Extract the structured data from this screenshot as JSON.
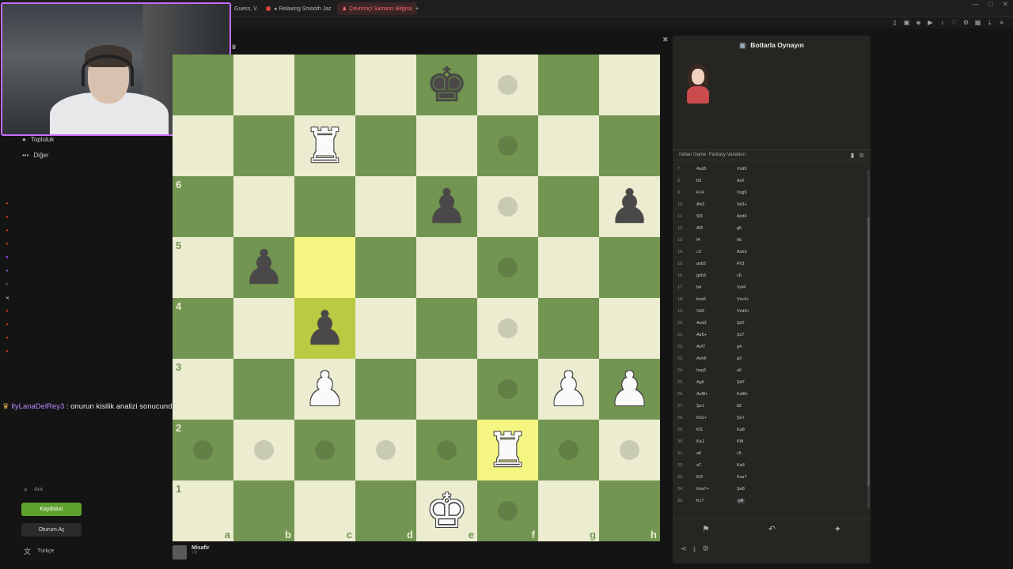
{
  "browser": {
    "tabs": [
      {
        "label": "Guess, V",
        "active": false
      },
      {
        "label": "Relaxing Smooth Jaz",
        "active": false
      },
      {
        "label": "Çevrimiçi Satrancı Bilgisa",
        "active": true
      },
      {
        "label": "+",
        "active": false
      }
    ]
  },
  "sidebar": {
    "items": [
      {
        "label": "Topluluk"
      },
      {
        "label": "Diğer",
        "icon": "more-icon"
      }
    ],
    "search_label": "Ara",
    "signup_label": "Kaydolun",
    "login_label": "Oturum Aç",
    "language_label": "Türkçe"
  },
  "chat": {
    "username": "IlyLanaDelRey3",
    "message": ": onurun kisilik analizi sonucunda bir seyler bul"
  },
  "board": {
    "rank_labels": [
      "6",
      "5",
      "4",
      "3",
      "2",
      "1"
    ],
    "file_labels": [
      "a",
      "b",
      "c",
      "d",
      "e",
      "f",
      "g",
      "h"
    ],
    "pieces": [
      {
        "square": "e8",
        "symbol": "♚",
        "color": "b",
        "name": "black-king"
      },
      {
        "square": "c7",
        "symbol": "♜",
        "color": "w",
        "name": "white-rook"
      },
      {
        "square": "e6",
        "symbol": "♟",
        "color": "b",
        "name": "black-pawn"
      },
      {
        "square": "h6",
        "symbol": "♟",
        "color": "b",
        "name": "black-pawn"
      },
      {
        "square": "b5",
        "symbol": "♟",
        "color": "b",
        "name": "black-pawn"
      },
      {
        "square": "c4",
        "symbol": "♟",
        "color": "b",
        "name": "black-pawn"
      },
      {
        "square": "c3",
        "symbol": "♟",
        "color": "w",
        "name": "white-pawn"
      },
      {
        "square": "g3",
        "symbol": "♟",
        "color": "w",
        "name": "white-pawn"
      },
      {
        "square": "h3",
        "symbol": "♟",
        "color": "w",
        "name": "white-pawn"
      },
      {
        "square": "f2",
        "symbol": "♜",
        "color": "w",
        "name": "white-rook"
      },
      {
        "square": "e1",
        "symbol": "♚",
        "color": "w",
        "name": "white-king"
      }
    ],
    "highlights": [
      "c5",
      "c4",
      "f2"
    ],
    "hints": [
      "f8",
      "f7",
      "f6",
      "f5",
      "f4",
      "f3",
      "a2",
      "b2",
      "c2",
      "d2",
      "e2",
      "g2",
      "h2",
      "f1"
    ]
  },
  "player": {
    "name": "Misafir",
    "rating_text": "+9"
  },
  "panel": {
    "title": "Botlarla Oynayın",
    "opening": "Indian Game: Fantasy Variation",
    "moves": [
      {
        "n": "7.",
        "w": "Axd5",
        "b": "Vxd5"
      },
      {
        "n": "8.",
        "w": "b3",
        "b": "Ac6"
      },
      {
        "n": "9.",
        "w": "Fc4",
        "b": "Vxg5"
      },
      {
        "n": "10.",
        "w": "Ah3",
        "b": "Ve3+"
      },
      {
        "n": "11.",
        "w": "Şf1",
        "b": "Axd4"
      },
      {
        "n": "12.",
        "w": "Af2",
        "b": "g5"
      },
      {
        "n": "13.",
        "w": "f4",
        "b": "h6"
      },
      {
        "n": "14.",
        "w": "c3",
        "b": "Axb3"
      },
      {
        "n": "15.",
        "w": "axb3",
        "b": "Fh3"
      },
      {
        "n": "16.",
        "w": "gxh3",
        "b": "c6"
      },
      {
        "n": "17.",
        "w": "b4",
        "b": "Vxf4"
      },
      {
        "n": "18.",
        "w": "bxa5",
        "b": "Vxc4+"
      },
      {
        "n": "19.",
        "w": "Vd3",
        "b": "Vxd3+"
      },
      {
        "n": "20.",
        "w": "Axd3",
        "b": "Şd7"
      },
      {
        "n": "21.",
        "w": "Ae5+",
        "b": "Şc7"
      },
      {
        "n": "22.",
        "w": "Axf7",
        "b": "g4"
      },
      {
        "n": "23.",
        "w": "Axh8",
        "b": "g3"
      },
      {
        "n": "24.",
        "w": "hxg3",
        "b": "e6"
      },
      {
        "n": "25.",
        "w": "Ag6",
        "b": "Şd7"
      },
      {
        "n": "26.",
        "w": "Axf8+",
        "b": "Kxf8+"
      },
      {
        "n": "27.",
        "w": "Şe1",
        "b": "b5"
      },
      {
        "n": "28.",
        "w": "Kd1+",
        "b": "Şe7"
      },
      {
        "n": "29.",
        "w": "Kf1",
        "b": "Ka8"
      },
      {
        "n": "30.",
        "w": "Ka1",
        "b": "Kf8"
      },
      {
        "n": "31.",
        "w": "a6",
        "b": "c5"
      },
      {
        "n": "32.",
        "w": "a7",
        "b": "Ka8"
      },
      {
        "n": "33.",
        "w": "Kf2",
        "b": "Kxa7"
      },
      {
        "n": "34.",
        "w": "Kxa7+",
        "b": "Şe8"
      },
      {
        "n": "35.",
        "w": "Kc7",
        "b": "c4"
      }
    ],
    "current_move_index": 28
  },
  "colors": {
    "board_light": "#ebecd0",
    "board_dark": "#739552",
    "highlight_light": "#f5f682",
    "highlight_dark": "#b9ca43",
    "accent_green": "#5ea22d",
    "webcam_border": "#c86cff"
  }
}
